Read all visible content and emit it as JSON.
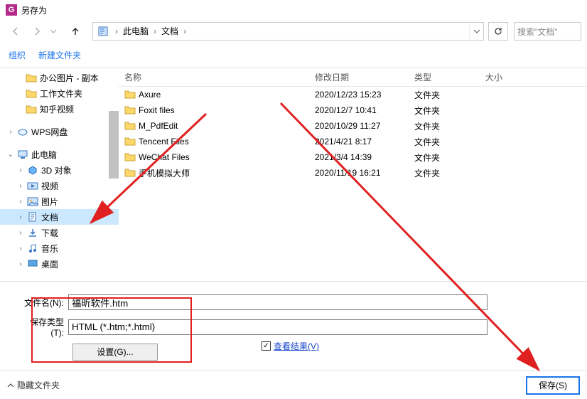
{
  "window": {
    "title": "另存为"
  },
  "nav": {
    "breadcrumb": [
      "此电脑",
      "文档"
    ],
    "search_placeholder": "搜索\"文档\""
  },
  "toolbar": {
    "organize": "组织",
    "new_folder": "新建文件夹"
  },
  "sidebar": {
    "items": [
      {
        "label": "办公图片 - 副本",
        "icon": "folder",
        "indent": 1
      },
      {
        "label": "工作文件夹",
        "icon": "folder",
        "indent": 1
      },
      {
        "label": "知乎视频",
        "icon": "folder",
        "indent": 1
      },
      {
        "label": "WPS网盘",
        "icon": "wps",
        "indent": 0,
        "expandable": true
      },
      {
        "label": "此电脑",
        "icon": "pc",
        "indent": 0,
        "expandable": true,
        "expanded": true
      },
      {
        "label": "3D 对象",
        "icon": "3d",
        "indent": 1,
        "expandable": true
      },
      {
        "label": "视频",
        "icon": "video",
        "indent": 1,
        "expandable": true
      },
      {
        "label": "图片",
        "icon": "pictures",
        "indent": 1,
        "expandable": true
      },
      {
        "label": "文档",
        "icon": "documents",
        "indent": 1,
        "expandable": true,
        "selected": true
      },
      {
        "label": "下载",
        "icon": "downloads",
        "indent": 1,
        "expandable": true
      },
      {
        "label": "音乐",
        "icon": "music",
        "indent": 1,
        "expandable": true
      },
      {
        "label": "桌面",
        "icon": "desktop",
        "indent": 1,
        "expandable": true
      }
    ]
  },
  "columns": {
    "name": "名称",
    "date": "修改日期",
    "type": "类型",
    "size": "大小"
  },
  "rows": [
    {
      "name": "Axure",
      "date": "2020/12/23 15:23",
      "type": "文件夹"
    },
    {
      "name": "Foxit files",
      "date": "2020/12/7 10:41",
      "type": "文件夹"
    },
    {
      "name": "M_PdfEdit",
      "date": "2020/10/29 11:27",
      "type": "文件夹"
    },
    {
      "name": "Tencent Files",
      "date": "2021/4/21 8:17",
      "type": "文件夹"
    },
    {
      "name": "WeChat Files",
      "date": "2021/3/4 14:39",
      "type": "文件夹"
    },
    {
      "name": "手机模拟大师",
      "date": "2020/11/19 16:21",
      "type": "文件夹"
    }
  ],
  "form": {
    "filename_label": "文件名(N):",
    "filename_value": "福昕软件.htm",
    "savetype_label": "保存类型(T):",
    "savetype_value": "HTML (*.htm;*.html)",
    "settings_label": "设置(G)...",
    "view_result_label": "查看结果(V)"
  },
  "footer": {
    "hide_folders": "隐藏文件夹",
    "save": "保存(S)"
  }
}
